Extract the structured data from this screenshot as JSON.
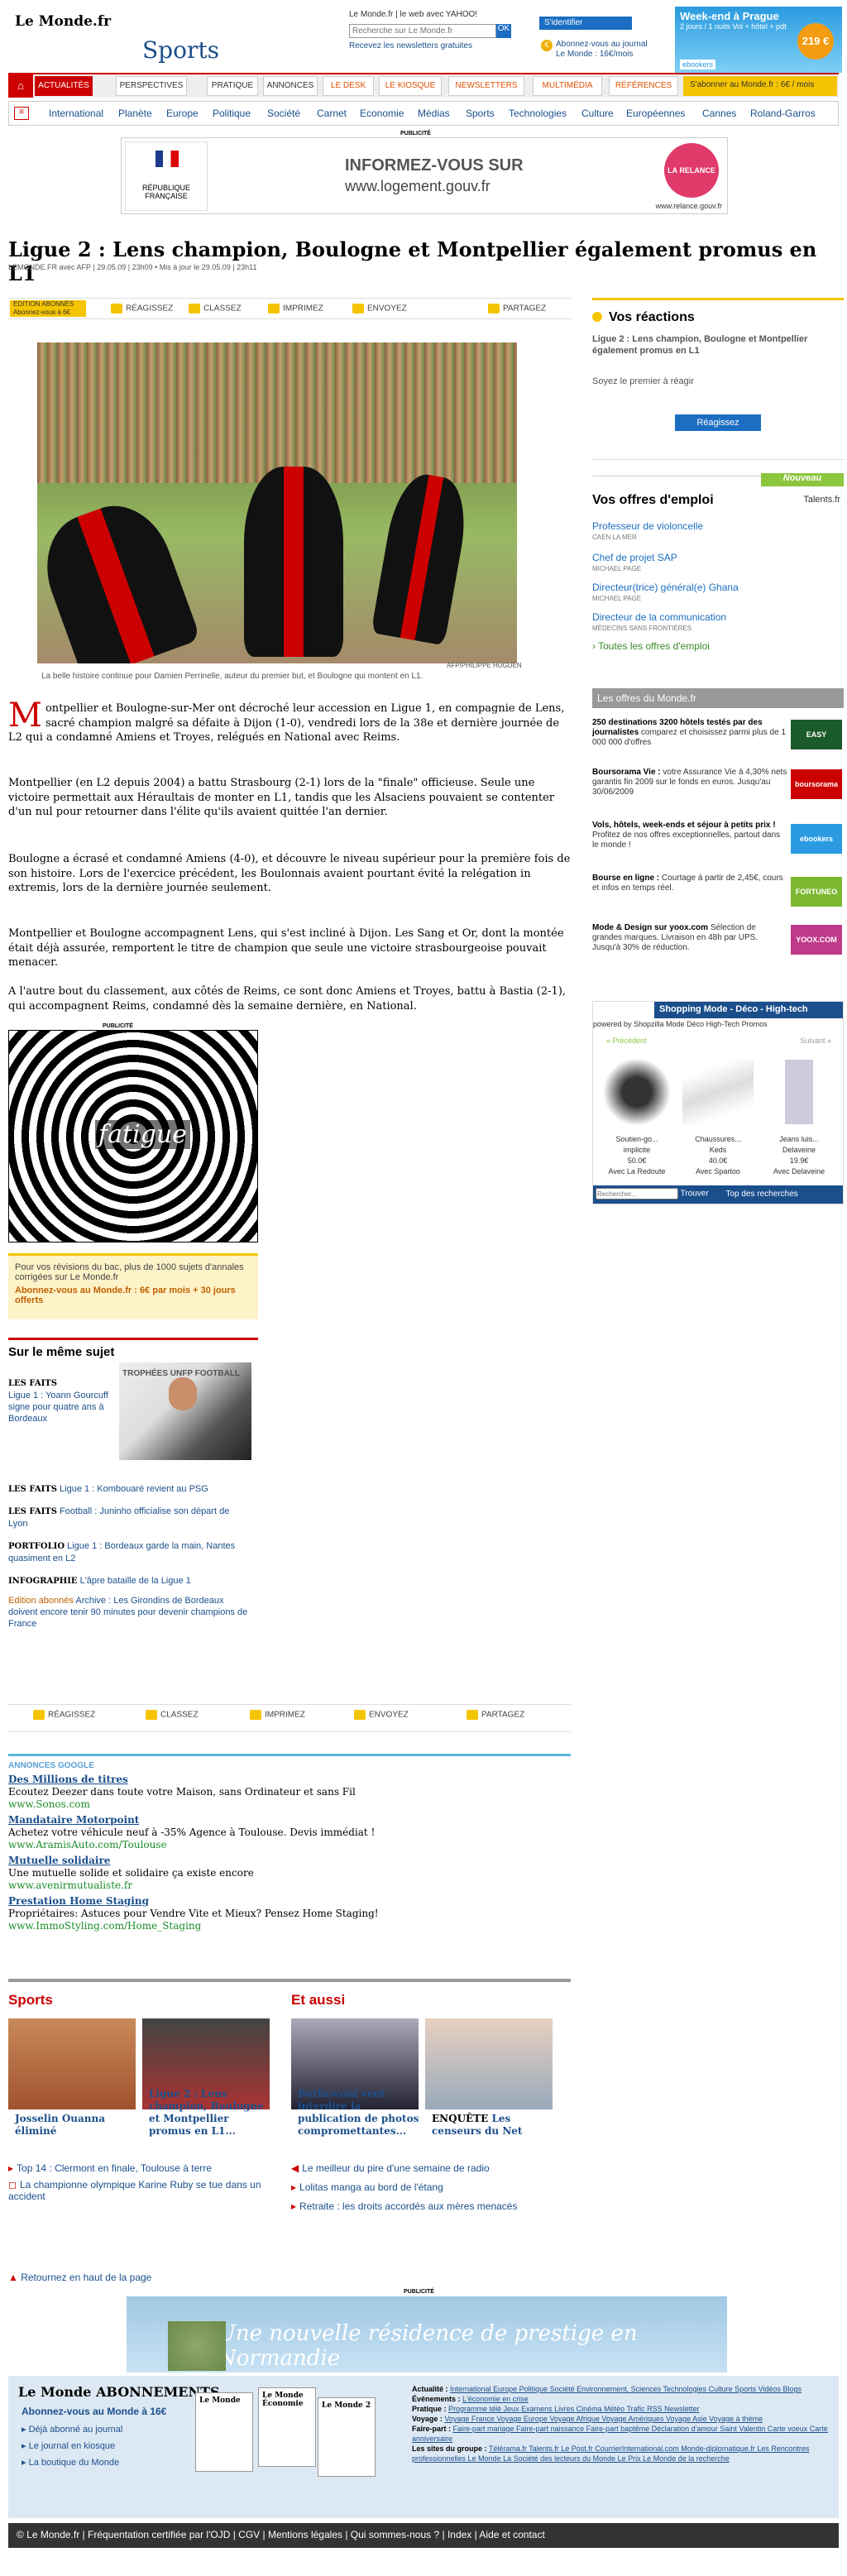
{
  "header": {
    "logo": "Le Monde.fr",
    "section": "Sports",
    "login_line": "Le Monde.fr  |  le web avec YAHOO!",
    "search_placeholder": "Recherche sur Le Monde.fr",
    "search_go": "OK",
    "newsletter": "Recevez les newsletters gratuites",
    "login": "S'identifier",
    "abonne": "Abonnez-vous au journal Le Monde : 16€/mois",
    "promo_title": "Week-end à Prague",
    "promo_sub": "2 jours / 1 nuits Vol + hôtel + pdt",
    "promo_price": "219 €",
    "promo_brand": "ebookers"
  },
  "nav": {
    "tabs": [
      "ACTUALITÉS",
      "PERSPECTIVES",
      "PRATIQUE",
      "ANNONCES",
      "LE DESK",
      "LE KIOSQUE",
      "NEWSLETTERS",
      "MULTIMÉDIA",
      "RÉFÉRENCES"
    ],
    "abo": "S'abonner au Monde.fr : 6€ / mois",
    "sub": [
      "International",
      "Planète",
      "Europe",
      "Politique",
      "Société",
      "Carnet",
      "Economie",
      "Médias",
      "Sports",
      "Technologies",
      "Culture",
      "Européennes",
      "Cannes",
      "Roland-Garros"
    ]
  },
  "ads": {
    "label": "PUBLICITÉ",
    "ad1_l1": "INFORMEZ-VOUS SUR",
    "ad1_l2": "www.logement.gouv.fr",
    "ad1_left": "RÉPUBLIQUE FRANÇAISE",
    "ad1_right": "LA RELANCE",
    "ad1_url": "www.relance.gouv.fr",
    "ad2": "Une nouvelle résidence de prestige en Normandie"
  },
  "article": {
    "title": "Ligue 2 : Lens champion, Boulogne et Montpellier également promus en L1",
    "byline": "LEMONDE.FR avec AFP | 29.05.09 | 23h09  •  Mis à jour le 29.05.09 | 23h11",
    "toolbar": {
      "edition": "EDITION ABONNÉS Abonnez-vous à 6€",
      "items": [
        "RÉAGISSEZ",
        "CLASSEZ",
        "IMPRIMEZ",
        "ENVOYEZ",
        "PARTAGEZ"
      ]
    },
    "photo_credit": "AFP/PHILIPPE HUGUEN",
    "caption": "La belle histoire continue pour Damien Perrinelle, auteur du premier but, et Boulogne qui montent en L1.",
    "drop": "M",
    "p1": "ontpellier et Boulogne-sur-Mer ont décroché leur accession en Ligue 1, en compagnie de Lens, sacré champion malgré sa défaite à Dijon (1-0), vendredi lors de la 38e et dernière journée de L2 qui a condamné Amiens et Troyes, relégués en National avec Reims.",
    "p2": "Montpellier (en L2 depuis 2004) a battu Strasbourg (2-1) lors de la \"finale\" officieuse. Seule une victoire permettait aux Héraultais de monter en L1, tandis que les Alsaciens pouvaient se contenter d'un nul pour retourner dans l'élite qu'ils avaient quittée l'an dernier.",
    "p3": "Boulogne a écrasé et condamné Amiens (4-0), et découvre le niveau supérieur pour la première fois de son histoire. Lors de l'exercice précédent, les Boulonnais avaient pourtant évité la relégation in extremis, lors de la dernière journée seulement.",
    "p4": "Montpellier et Boulogne accompagnent Lens, qui s'est incliné à Dijon. Les Sang et Or, dont la montée était déjà assurée, remportent le titre de champion que seule une victoire strasbourgeoise pouvait menacer.",
    "p5": "A l'autre bout du classement, aux côtés de Reims, ce sont donc Amiens et Troyes, battu à Bastia (2-1), qui accompagnent Reims, condamné dès la semaine dernière, en National."
  },
  "spiral": {
    "text": "fatigue"
  },
  "bac": {
    "text": "Pour vos révisions du bac, plus de 1000 sujets d'annales corrigées sur Le Monde.fr",
    "cta": "Abonnez-vous au Monde.fr : 6€ par mois + 30 jours offerts"
  },
  "same": {
    "title": "Sur le même sujet",
    "img": "TROPHÉES UNFP FOOTBALL",
    "items": [
      {
        "tag": "LES FAITS",
        "text": "Ligue 1 : Yoann Gourcuff signe pour quatre ans à Bordeaux"
      },
      {
        "tag": "LES FAITS",
        "text": "Ligue 1 : Kombouaré revient au PSG"
      },
      {
        "tag": "LES FAITS",
        "text": "Football : Juninho officialise son départ de Lyon"
      },
      {
        "tag": "PORTFOLIO",
        "text": "Ligue 1 : Bordeaux garde la main, Nantes quasiment en L2"
      },
      {
        "tag": "INFOGRAPHIE",
        "text": "L'âpre bataille de la Ligue 1"
      },
      {
        "tag": "Edition abonnés",
        "text": "Archive : Les Girondins de Bordeaux doivent encore tenir 90 minutes pour devenir champions de France"
      }
    ]
  },
  "google": {
    "head": "ANNONCES GOOGLE",
    "items": [
      {
        "t": "Des Millions de titres",
        "d": "Ecoutez Deezer dans toute votre Maison, sans Ordinateur et sans Fil",
        "u": "www.Sonos.com"
      },
      {
        "t": "Mandataire Motorpoint",
        "d": "Achetez votre véhicule neuf à -35% Agence à Toulouse. Devis immédiat !",
        "u": "www.AramisAuto.com/Toulouse"
      },
      {
        "t": "Mutuelle solidaire",
        "d": "Une mutuelle solide et solidaire ça existe encore",
        "u": "www.avenirmutualiste.fr"
      },
      {
        "t": "Prestation Home Staging",
        "d": "Propriétaires: Astuces pour Vendre Vite et Mieux? Pensez Home Staging!",
        "u": "www.ImmoStyling.com/Home_Staging"
      }
    ]
  },
  "bottom": {
    "sports": "Sports",
    "aussi": "Et aussi",
    "cards": [
      {
        "t": "Josselin Ouanna éliminé"
      },
      {
        "t": "Ligue 2 : Lens champion, Boulogne et Montpellier promus en L1..."
      },
      {
        "t": "Berlusconi veut interdire la publication de photos compromettantes..."
      },
      {
        "tag": "ENQUÊTE",
        "t": "Les censeurs du Net"
      }
    ],
    "left": [
      "Top 14 : Clermont en finale, Toulouse à terre",
      "La championne olympique Karine Ruby se tue dans un accident"
    ],
    "right": [
      "Le meilleur du pire d'une semaine de radio",
      "Lolitas manga au bord de l'étang",
      "Retraite : les droits accordés aux mères menacés"
    ],
    "top": "Retournez en haut de la page"
  },
  "footer": {
    "logo": "Le Monde ABONNEMENTS",
    "abo": "Abonnez-vous au Monde à 16€",
    "links": [
      "Déjà abonné au journal",
      "Le journal en kiosque",
      "La boutique du Monde"
    ],
    "papers": [
      "Le Monde",
      "Le Monde Économie",
      "Le Monde 2"
    ],
    "cols": [
      {
        "k": "Actualité :",
        "v": "International  Europe  Politique  Société  Environnement, Sciences  Technologies  Culture  Sports  Vidéos  Blogs"
      },
      {
        "k": "Événements :",
        "v": "L'économie en crise"
      },
      {
        "k": "Pratique :",
        "v": "Programme télé  Jeux  Examens  Livres  Cinéma  Météo  Trafic  RSS  Newsletter"
      },
      {
        "k": "Voyage :",
        "v": "Voyage France  Voyage Europe  Voyage Afrique  Voyage Amériques  Voyage Asie  Voyage à thème"
      },
      {
        "k": "Faire-part :",
        "v": "Faire-part mariage  Faire-part naissance  Faire-part baptême  Déclaration d'amour  Saint Valentin  Carte voeux  Carte anniversaire"
      },
      {
        "k": "Les sites du groupe :",
        "v": "Télérama.fr  Talents.fr  Le Post.fr  CourrierInternational.com  Monde-diplomatique.fr  Les Rencontres professionnelles Le Monde  La Société des lecteurs du Monde  Le Prix Le Monde de la recherche"
      }
    ],
    "bar": "© Le Monde.fr | Fréquentation certifiée par l'OJD | CGV | Mentions légales | Qui sommes-nous ? | Index | Aide et contact"
  },
  "right": {
    "react_h": "Vos réactions",
    "react_t": "Ligue 2 : Lens champion, Boulogne et Montpellier également promus en L1",
    "react_t2": "Soyez le premier à réagir",
    "react_b": "Réagissez",
    "jobs_new": "Nouveau",
    "jobs_h": "Vos offres d'emploi",
    "jobs_brand": "Talents.fr",
    "jobs": [
      {
        "t": "Professeur de violoncelle",
        "c": "CAEN LA MER"
      },
      {
        "t": "Chef de projet SAP",
        "c": "MICHAEL PAGE"
      },
      {
        "t": "Directeur(trice) général(e) Ghana",
        "c": "MICHAEL PAGE"
      },
      {
        "t": "Directeur de la communication",
        "c": "MÉDECINS SANS FRONTIÈRES"
      }
    ],
    "jobs_all": "Toutes les offres d'emploi",
    "offres_h": "Les offres du Monde.fr",
    "offres": [
      {
        "b": "250 destinations 3200 hôtels testés par des journalistes",
        "t": "comparez et choisissez parmi plus de 1 000 000 d'offres",
        "l": "EASY VOYAGE",
        "c": "#1b5a2a"
      },
      {
        "b": "Boursorama Vie :",
        "t": "votre Assurance Vie à 4,30% nets garantis fin 2009 sur le fonds en euros. Jusqu'au 30/06/2009",
        "l": "boursorama banque",
        "c": "#c00"
      },
      {
        "b": "Vols, hôtels, week-ends et séjour à petits prix !",
        "t": "Profitez de nos offres exceptionnelles, partout dans le monde !",
        "l": "ebookers",
        "c": "#2a9be0"
      },
      {
        "b": "Bourse en ligne :",
        "t": "Courtage à partir de 2,45€, cours et infos en temps réel.",
        "l": "FORTUNEO",
        "c": "#7cb830"
      },
      {
        "b": "Mode & Design sur yoox.com",
        "t": "Sélection de grandes marques. Livraison en 48h par UPS. Jusqu'à 30% de réduction.",
        "l": "YOOX.COM",
        "c": "#c0398a"
      }
    ],
    "shop_h": "Shopping Mode - Déco - High-tech",
    "shop_tabs": "powered by Shopzilla    Mode    Déco    High-Tech    Promos",
    "prev": "« Précédent",
    "next": "Suivant »",
    "prods": [
      {
        "n": "Soutien-go...",
        "m": "implicite",
        "p": "50.0€",
        "s": "Avec La Redoute"
      },
      {
        "n": "Chaussures...",
        "m": "Keds",
        "p": "40.0€",
        "s": "Avec Spartoo"
      },
      {
        "n": "Jeans luis...",
        "m": "Delaveine",
        "p": "19.9€",
        "s": "Avec Delaveine"
      }
    ],
    "shop_search": "Rechercher...",
    "shop_btn": "Trouver",
    "shop_top": "Top des recherches"
  }
}
